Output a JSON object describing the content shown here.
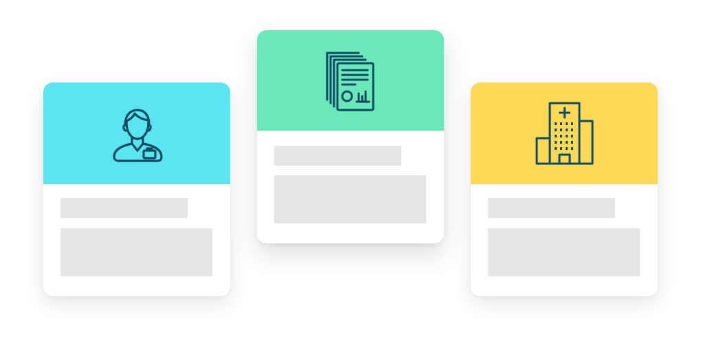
{
  "cards": [
    {
      "icon": "user-badge-icon",
      "header_color": "#5ce4f0"
    },
    {
      "icon": "document-report-icon",
      "header_color": "#6ae8b8"
    },
    {
      "icon": "hospital-icon",
      "header_color": "#fdd956"
    }
  ],
  "colors": {
    "icon_stroke": "#0d4a63",
    "placeholder": "#e6e6e6",
    "card_background": "#ffffff"
  }
}
